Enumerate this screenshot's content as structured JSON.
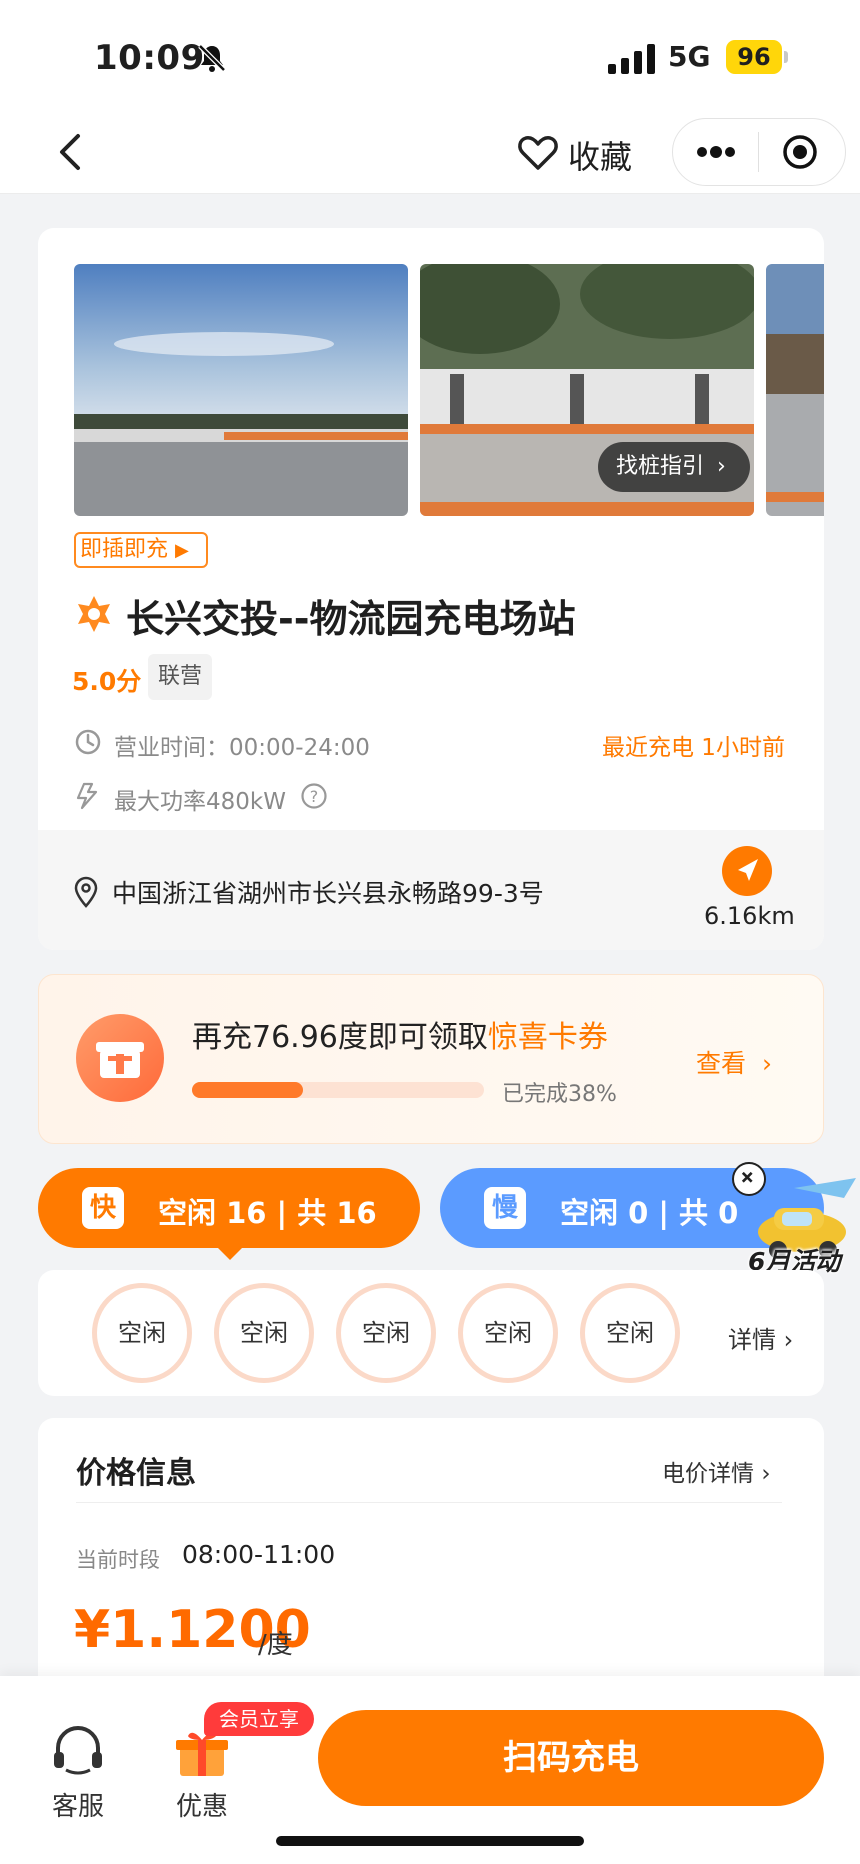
{
  "status_bar": {
    "time": "10:09",
    "network": "5G",
    "battery": "96"
  },
  "nav": {
    "favorite_label": "收藏"
  },
  "station": {
    "guide_label": "找桩指引",
    "plug_tag": "即插即充",
    "name": "长兴交投--物流园充电场站",
    "rating": "5.0分",
    "operator_tag": "联营",
    "hours_label": "营业时间：",
    "hours_value": "00:00-24:00",
    "recent_charge": "最近充电 1小时前",
    "max_power": "最大功率480kW",
    "address": "中国浙江省湖州市长兴县永畅路99-3号",
    "distance": "6.16km"
  },
  "promo": {
    "text_prefix": "再充76.96度即可领取",
    "text_highlight": "惊喜卡券",
    "progress_percent": 38,
    "progress_label": "已完成38%",
    "view_label": "查看"
  },
  "chargers": {
    "fast_badge": "快",
    "fast_text": "空闲 16 | 共 16",
    "slow_badge": "慢",
    "slow_text": "空闲 0 | 共 0",
    "slots": [
      "空闲",
      "空闲",
      "空闲",
      "空闲",
      "空闲"
    ],
    "details_label": "详情"
  },
  "activity": {
    "label": "6月活动"
  },
  "price": {
    "title": "价格信息",
    "detail_link": "电价详情",
    "period_label": "当前时段",
    "period_value": "08:00-11:00",
    "value": "¥1.1200",
    "unit": "/度"
  },
  "bottom": {
    "service_label": "客服",
    "discount_label": "优惠",
    "member_badge": "会员立享",
    "scan_label": "扫码充电"
  },
  "colors": {
    "accent": "#ff7a00",
    "slow_blue": "#5b9bff",
    "price_orange": "#ff6a00"
  }
}
